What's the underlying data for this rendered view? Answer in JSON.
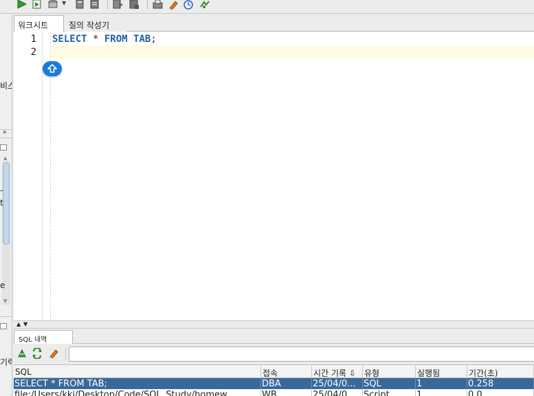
{
  "tabs": [
    {
      "label": "워크시트",
      "active": true
    },
    {
      "label": "질의 작성기",
      "active": false
    }
  ],
  "toolbar": {
    "icons": [
      "run-statement-icon",
      "run-script-icon",
      "commit-icon",
      "rollback-icon",
      "explain-plan-icon",
      "autotrace-icon",
      "clear-icon",
      "format-icon",
      "history-icon",
      "tuning-icon"
    ]
  },
  "left_panel": {
    "text_top": "비스",
    "text_bottom": "기력"
  },
  "editor": {
    "line_numbers": [
      "1",
      "2"
    ],
    "line1": {
      "kw1": "SELECT",
      "star": " * ",
      "kw2": "FROM",
      "space": " ",
      "kw3": "TAB",
      "semi": ";"
    }
  },
  "history": {
    "tab_label": "SQL 내역",
    "columns": [
      "SQL",
      "접속",
      "시간 기록 ⇩",
      "유형",
      "실행됨",
      "기간(초)"
    ],
    "rows": [
      {
        "sql": "SELECT * FROM TAB;",
        "conn": "DBA",
        "time": "25/04/0...",
        "type": "SQL",
        "executed": "1",
        "duration": "0.258",
        "selected": true
      },
      {
        "sql": "file:/Users/kki/Desktop/Code/SQL_Study/homew",
        "conn": "WB",
        "time": "25/04/0",
        "type": "Script",
        "executed": "1",
        "duration": "0.0",
        "selected": false
      }
    ]
  },
  "colors": {
    "keyword": "#1f5f9e",
    "selection": "#39689b",
    "current_line": "#fffbe0",
    "fab": "#1e7ae0"
  }
}
